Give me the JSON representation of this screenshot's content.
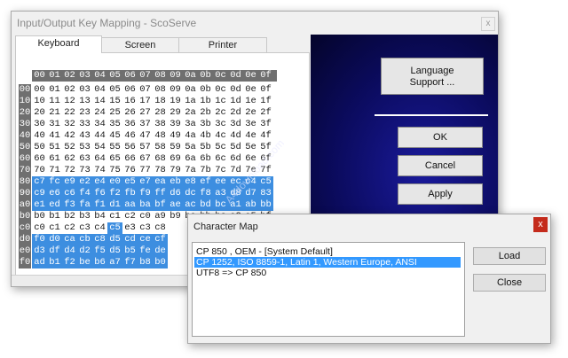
{
  "main_window": {
    "title": "Input/Output Key Mapping  - ScoServe",
    "close_label": "x",
    "tabs": [
      {
        "label": "Keyboard"
      },
      {
        "label": "Screen"
      },
      {
        "label": "Printer"
      }
    ],
    "buttons": {
      "language_line1": "Language",
      "language_line2": "Support ...",
      "ok": "OK",
      "cancel": "Cancel",
      "apply": "Apply"
    },
    "watermark": "A4download.com"
  },
  "grid": {
    "col_headers": [
      "00",
      "01",
      "02",
      "03",
      "04",
      "05",
      "06",
      "07",
      "08",
      "09",
      "0a",
      "0b",
      "0c",
      "0d",
      "0e",
      "0f"
    ],
    "rows": [
      {
        "hdr": "00",
        "cells": [
          "00",
          "01",
          "02",
          "03",
          "04",
          "05",
          "06",
          "07",
          "08",
          "09",
          "0a",
          "0b",
          "0c",
          "0d",
          "0e",
          "0f"
        ]
      },
      {
        "hdr": "10",
        "cells": [
          "10",
          "11",
          "12",
          "13",
          "14",
          "15",
          "16",
          "17",
          "18",
          "19",
          "1a",
          "1b",
          "1c",
          "1d",
          "1e",
          "1f"
        ]
      },
      {
        "hdr": "20",
        "cells": [
          "20",
          "21",
          "22",
          "23",
          "24",
          "25",
          "26",
          "27",
          "28",
          "29",
          "2a",
          "2b",
          "2c",
          "2d",
          "2e",
          "2f"
        ]
      },
      {
        "hdr": "30",
        "cells": [
          "30",
          "31",
          "32",
          "33",
          "34",
          "35",
          "36",
          "37",
          "38",
          "39",
          "3a",
          "3b",
          "3c",
          "3d",
          "3e",
          "3f"
        ]
      },
      {
        "hdr": "40",
        "cells": [
          "40",
          "41",
          "42",
          "43",
          "44",
          "45",
          "46",
          "47",
          "48",
          "49",
          "4a",
          "4b",
          "4c",
          "4d",
          "4e",
          "4f"
        ]
      },
      {
        "hdr": "50",
        "cells": [
          "50",
          "51",
          "52",
          "53",
          "54",
          "55",
          "56",
          "57",
          "58",
          "59",
          "5a",
          "5b",
          "5c",
          "5d",
          "5e",
          "5f"
        ]
      },
      {
        "hdr": "60",
        "cells": [
          "60",
          "61",
          "62",
          "63",
          "64",
          "65",
          "66",
          "67",
          "68",
          "69",
          "6a",
          "6b",
          "6c",
          "6d",
          "6e",
          "6f"
        ]
      },
      {
        "hdr": "70",
        "cells": [
          "70",
          "71",
          "72",
          "73",
          "74",
          "75",
          "76",
          "77",
          "78",
          "79",
          "7a",
          "7b",
          "7c",
          "7d",
          "7e",
          "7f"
        ]
      },
      {
        "hdr": "80",
        "cells": [
          "c7",
          "fc",
          "e9",
          "e2",
          "e4",
          "e0",
          "e5",
          "e7",
          "ea",
          "eb",
          "e8",
          "ef",
          "ee",
          "ec",
          "c4",
          "c5"
        ]
      },
      {
        "hdr": "90",
        "cells": [
          "c9",
          "e6",
          "c6",
          "f4",
          "f6",
          "f2",
          "fb",
          "f9",
          "ff",
          "d6",
          "dc",
          "f8",
          "a3",
          "d8",
          "d7",
          "83"
        ]
      },
      {
        "hdr": "a0",
        "cells": [
          "e1",
          "ed",
          "f3",
          "fa",
          "f1",
          "d1",
          "aa",
          "ba",
          "bf",
          "ae",
          "ac",
          "bd",
          "bc",
          "a1",
          "ab",
          "bb"
        ]
      },
      {
        "hdr": "b0",
        "cells": [
          "b0",
          "b1",
          "b2",
          "b3",
          "b4",
          "c1",
          "c2",
          "c0",
          "a9",
          "b9",
          "ba",
          "bb",
          "bc",
          "a2",
          "a5",
          "bf"
        ]
      },
      {
        "hdr": "c0",
        "cells": [
          "c0",
          "c1",
          "c2",
          "c3",
          "c4",
          "c5",
          "e3",
          "c3",
          "c8",
          "",
          "",
          "",
          "",
          "",
          "",
          ""
        ]
      },
      {
        "hdr": "d0",
        "cells": [
          "f0",
          "d0",
          "ca",
          "cb",
          "c8",
          "d5",
          "cd",
          "ce",
          "cf",
          "",
          "",
          "",
          "",
          "",
          "",
          ""
        ]
      },
      {
        "hdr": "e0",
        "cells": [
          "d3",
          "df",
          "d4",
          "d2",
          "f5",
          "d5",
          "b5",
          "fe",
          "de",
          "",
          "",
          "",
          "",
          "",
          "",
          ""
        ]
      },
      {
        "hdr": "f0",
        "cells": [
          "ad",
          "b1",
          "f2",
          "be",
          "b6",
          "a7",
          "f7",
          "b8",
          "b0",
          "",
          "",
          "",
          "",
          "",
          "",
          ""
        ]
      }
    ]
  },
  "dialog": {
    "title": "Character Map",
    "close_label": "x",
    "items": [
      "CP 850 , OEM  - [System Default]",
      "CP 1252, ISO 8859-1,  Latin 1,  Western Europe,  ANSI",
      "UTF8 => CP 850"
    ],
    "selected_index": 1,
    "buttons": {
      "load": "Load",
      "close": "Close"
    }
  }
}
